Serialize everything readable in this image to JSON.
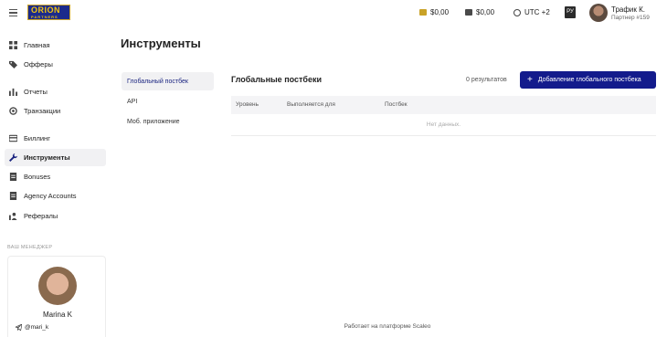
{
  "header": {
    "logo_text": "ORION",
    "logo_sub": "PARTNERS",
    "balance_1": "$0,00",
    "balance_2": "$0,00",
    "timezone": "UTC +2",
    "language": "РУ",
    "user_name": "Трафик К.",
    "user_sub": "Партнер #159",
    "icons": [
      "menu-icon",
      "wallet-gold-icon",
      "wallet-dark-icon",
      "clock-icon"
    ]
  },
  "sidebar": {
    "items": [
      {
        "label": "Главная",
        "icon": "dashboard-icon"
      },
      {
        "label": "Офферы",
        "icon": "tag-icon"
      },
      {
        "label": "Отчеты",
        "icon": "bar-chart-icon"
      },
      {
        "label": "Транзакции",
        "icon": "transactions-icon"
      },
      {
        "label": "Биллинг",
        "icon": "card-icon"
      },
      {
        "label": "Инструменты",
        "icon": "wrench-icon"
      },
      {
        "label": "Bonuses",
        "icon": "document-icon"
      },
      {
        "label": "Agency Accounts",
        "icon": "document-icon"
      },
      {
        "label": "Рефералы",
        "icon": "referrals-icon"
      }
    ],
    "active_item": "Инструменты",
    "manager_title": "ВАШ МЕНЕДЖЕР",
    "manager_name": "Marina K",
    "manager_telegram": "@mari_k"
  },
  "main": {
    "page_title": "Инструменты",
    "subnav": [
      {
        "label": "Глобальный постбек"
      },
      {
        "label": "API"
      },
      {
        "label": "Моб. приложение"
      }
    ],
    "section_title": "Глобальные постбеки",
    "results_text": "0  результатов",
    "add_button_label": "Добавление глобального постбека",
    "table": {
      "columns": [
        "Уровень",
        "Выполняется для",
        "Постбек"
      ],
      "empty_text": "Нет данных."
    }
  },
  "footer": {
    "text": "Работает на платформе Scaleo"
  },
  "colors": {
    "accent": "#131b8c",
    "active_bg": "#f1f1f3",
    "logo_bg": "#1b2a8c",
    "logo_text": "#f1c40f"
  }
}
